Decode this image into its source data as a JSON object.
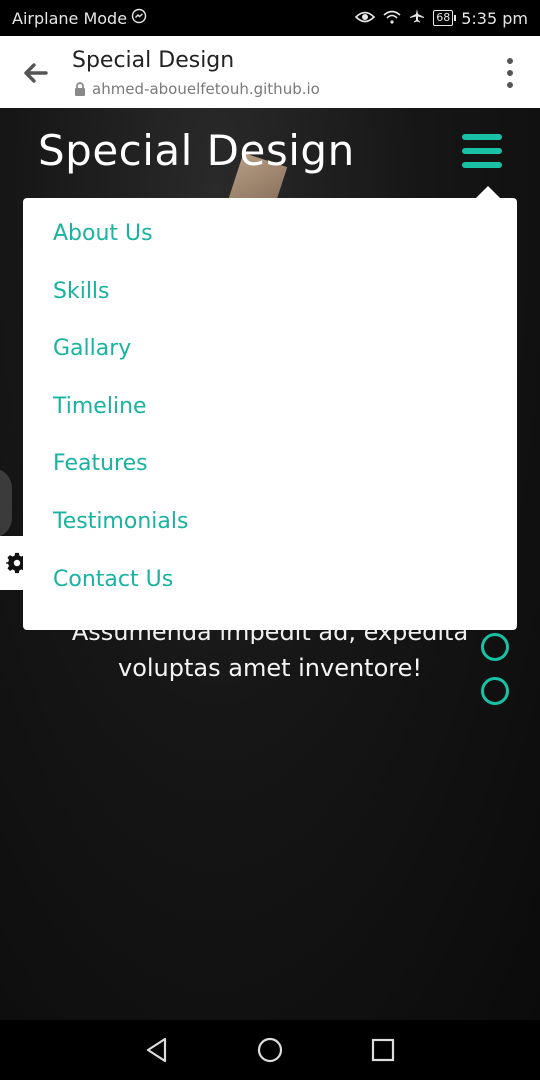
{
  "status": {
    "left_text": "Airplane Mode",
    "battery": "68",
    "time": "5:35 pm",
    "icons": [
      "messenger-icon",
      "eye-icon",
      "wifi-icon",
      "airplane-icon",
      "battery-icon"
    ]
  },
  "browser": {
    "title": "Special Design",
    "url": "ahmed-abouelfetouh.github.io"
  },
  "site": {
    "logo": "Special Design",
    "accent_color": "#19c1a5",
    "menu": [
      "About Us",
      "Skills",
      "Gallary",
      "Timeline",
      "Features",
      "Testimonials",
      "Contact Us"
    ],
    "hero_partial": "Assumenda impedit ad, expedita",
    "hero_line": "voluptas amet inventore!"
  },
  "nav": {
    "icons": [
      "back-triangle-icon",
      "home-circle-icon",
      "recents-square-icon"
    ]
  }
}
